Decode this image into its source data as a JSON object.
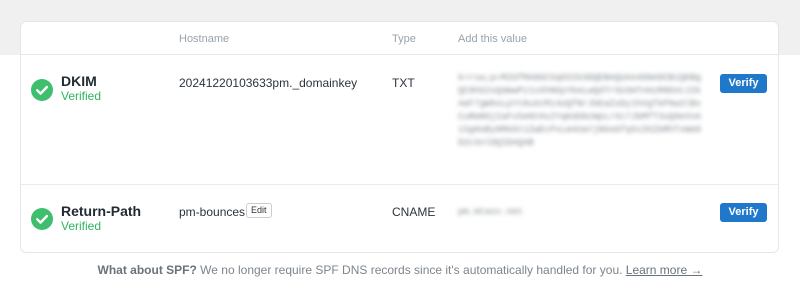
{
  "table": {
    "headers": {
      "hostname": "Hostname",
      "type": "Type",
      "value": "Add this value"
    }
  },
  "records": [
    {
      "name": "DKIM",
      "status": "Verified",
      "hostname": "20241220103633pm._domainkey",
      "type": "TXT",
      "value": "k=rsa;p=MIGfMA0GCSqGSIb3DQEBAQUAA4GNADCBiQKBgQC8hG2xQdmwPz1vXhN6pYKeLwQdTr5U3mTnHzR8bVcJ2kAeF7gW9sLpYt0uXcMi4oQfNrJbEaZsDy1hVgTkP6w3lBxCuRm8OjIaFv5eNtHs2YqKdG0zWpLrXc7JbMfT3uQ9eVnAiSgHoBy8RkDt1ZwEcPxLm4UaYjN6oGfq5sIKZbRhTvWe0D2cXnlOQIDAQAB",
      "verify_label": "Verify"
    },
    {
      "name": "Return-Path",
      "status": "Verified",
      "hostname": "pm-bounces",
      "edit_label": "Edit",
      "type": "CNAME",
      "value": "pm.mtasv.net",
      "verify_label": "Verify"
    }
  ],
  "footer": {
    "question": "What about SPF?",
    "text": " We no longer require SPF DNS records since it's automatically handled for you. ",
    "link": "Learn more →"
  },
  "colors": {
    "accent": "#1f78c9",
    "success": "#3fbf6e"
  }
}
